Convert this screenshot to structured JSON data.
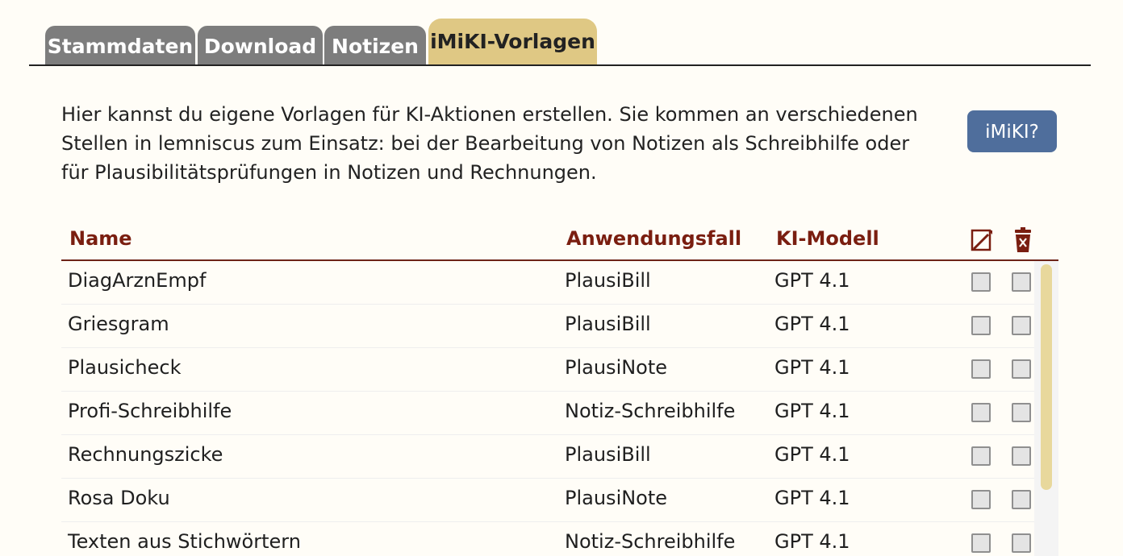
{
  "tabs": [
    {
      "label": "Stammdaten",
      "active": false
    },
    {
      "label": "Download",
      "active": false
    },
    {
      "label": "Notizen",
      "active": false
    },
    {
      "label": "iMiKI-Vorlagen",
      "active": true
    }
  ],
  "intro": {
    "line1": "Hier kannst du eigene Vorlagen für KI-Aktionen erstellen. Sie kommen an verschiedenen",
    "line2": "Stellen in lemniscus zum Einsatz: bei der Bearbeitung von Notizen als Schreibhilfe oder",
    "line3": "für Plausibilitätsprüfungen in Notizen und Rechnungen."
  },
  "help_button": {
    "label": "iMiKI?"
  },
  "table": {
    "headers": {
      "name": "Name",
      "usecase": "Anwendungsfall",
      "model": "KI-Modell",
      "edit_icon": "edit-icon",
      "delete_icon": "trash-icon"
    },
    "rows": [
      {
        "name": "DiagArznEmpf",
        "usecase": "PlausiBill",
        "model": "GPT 4.1"
      },
      {
        "name": "Griesgram",
        "usecase": "PlausiBill",
        "model": "GPT 4.1"
      },
      {
        "name": "Plausicheck",
        "usecase": "PlausiNote",
        "model": "GPT 4.1"
      },
      {
        "name": "Profi-Schreibhilfe",
        "usecase": "Notiz-Schreibhilfe",
        "model": "GPT 4.1"
      },
      {
        "name": "Rechnungszicke",
        "usecase": "PlausiBill",
        "model": "GPT 4.1"
      },
      {
        "name": "Rosa Doku",
        "usecase": "PlausiNote",
        "model": "GPT 4.1"
      },
      {
        "name": "Texten aus Stichwörtern",
        "usecase": "Notiz-Schreibhilfe",
        "model": "GPT 4.1"
      }
    ]
  },
  "colors": {
    "tab_inactive": "#7d7d7d",
    "tab_active": "#dfc884",
    "header_text": "#7a1e10",
    "button": "#4f6e9c",
    "scrollbar_thumb": "#e8d89c"
  }
}
